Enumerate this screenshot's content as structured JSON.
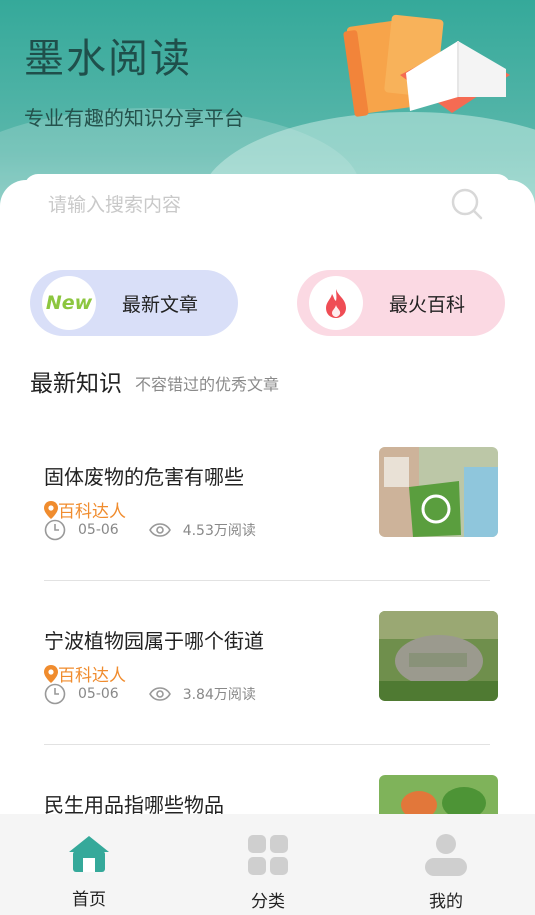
{
  "header": {
    "title": "墨水阅读",
    "subtitle": "专业有趣的知识分享平台"
  },
  "search": {
    "placeholder": "请输入搜索内容"
  },
  "quick": {
    "latest": {
      "label": "最新文章",
      "badge": "New"
    },
    "hot": {
      "label": "最火百科"
    }
  },
  "section": {
    "title": "最新知识",
    "subtitle": "不容错过的优秀文章"
  },
  "articles": [
    {
      "title": "固体废物的危害有哪些",
      "author": "百科达人",
      "date": "05-06",
      "views": "4.53万阅读"
    },
    {
      "title": "宁波植物园属于哪个街道",
      "author": "百科达人",
      "date": "05-06",
      "views": "3.84万阅读"
    },
    {
      "title": "民生用品指哪些物品"
    }
  ],
  "tabs": [
    {
      "label": "首页"
    },
    {
      "label": "分类"
    },
    {
      "label": "我的"
    }
  ],
  "colors": {
    "brand": "#35a99a",
    "accent_orange": "#f08c2e",
    "new_green": "#8cc63f",
    "hot_red": "#ef4d55"
  }
}
